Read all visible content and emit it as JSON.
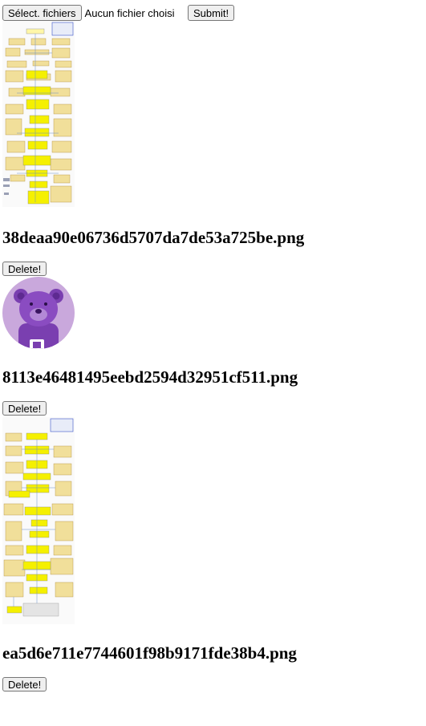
{
  "upload": {
    "choose_label": "Sélect. fichiers",
    "file_status": "Aucun fichier choisi",
    "submit_label": "Submit!"
  },
  "files": [
    {
      "name": "38deaa90e06736d5707da7de53a725be.png",
      "delete_label": "Delete!",
      "thumb_icon": "flowchart-diagram-icon"
    },
    {
      "name": "8113e46481495eebd2594d32951cf511.png",
      "delete_label": "Delete!",
      "thumb_icon": "purple-bear-avatar-icon"
    },
    {
      "name": "ea5d6e711e7744601f98b9171fde38b4.png",
      "delete_label": "Delete!",
      "thumb_icon": "flowchart-diagram-icon"
    }
  ]
}
